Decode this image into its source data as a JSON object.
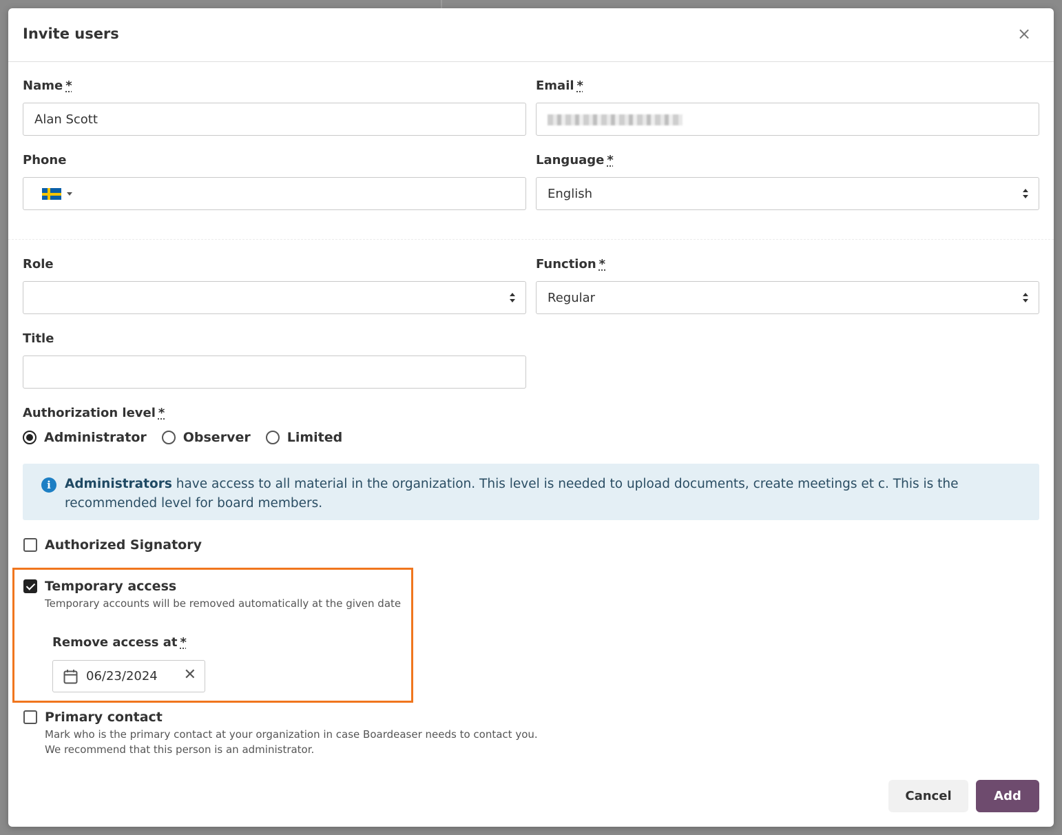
{
  "dialog": {
    "title": "Invite users",
    "close_label": "×"
  },
  "form": {
    "name": {
      "label": "Name",
      "required_mark": "*",
      "value": "Alan Scott"
    },
    "email": {
      "label": "Email",
      "required_mark": "*",
      "value": ""
    },
    "phone": {
      "label": "Phone",
      "country_flag": "sweden-flag-icon",
      "value": ""
    },
    "language": {
      "label": "Language",
      "required_mark": "*",
      "value": "English"
    },
    "role": {
      "label": "Role",
      "value": ""
    },
    "function": {
      "label": "Function",
      "required_mark": "*",
      "value": "Regular"
    },
    "title_field": {
      "label": "Title",
      "value": ""
    },
    "authorization": {
      "label": "Authorization level",
      "required_mark": "*",
      "options": [
        "Administrator",
        "Observer",
        "Limited"
      ],
      "selected": "Administrator"
    },
    "info": {
      "bold": "Administrators",
      "text": " have access to all material in the organization. This level is needed to upload documents, create meetings et c. This is the recommended level for board members.",
      "icon": "info-icon",
      "color": "#1d7fc4"
    },
    "authorized_signatory": {
      "label": "Authorized Signatory",
      "checked": false
    },
    "temporary_access": {
      "label": "Temporary access",
      "checked": true,
      "help": "Temporary accounts will be removed automatically at the given date",
      "remove_label": "Remove access at",
      "required_mark": "*",
      "date": "06/23/2024",
      "clear_label": "✕"
    },
    "primary_contact": {
      "label": "Primary contact",
      "checked": false,
      "help_line1": "Mark who is the primary contact at your organization in case Boardeaser needs to contact you.",
      "help_line2": "We recommend that this person is an administrator."
    }
  },
  "buttons": {
    "cancel": "Cancel",
    "add": "Add",
    "add_color": "#6e4b6e"
  },
  "highlight_color": "#f0761e"
}
